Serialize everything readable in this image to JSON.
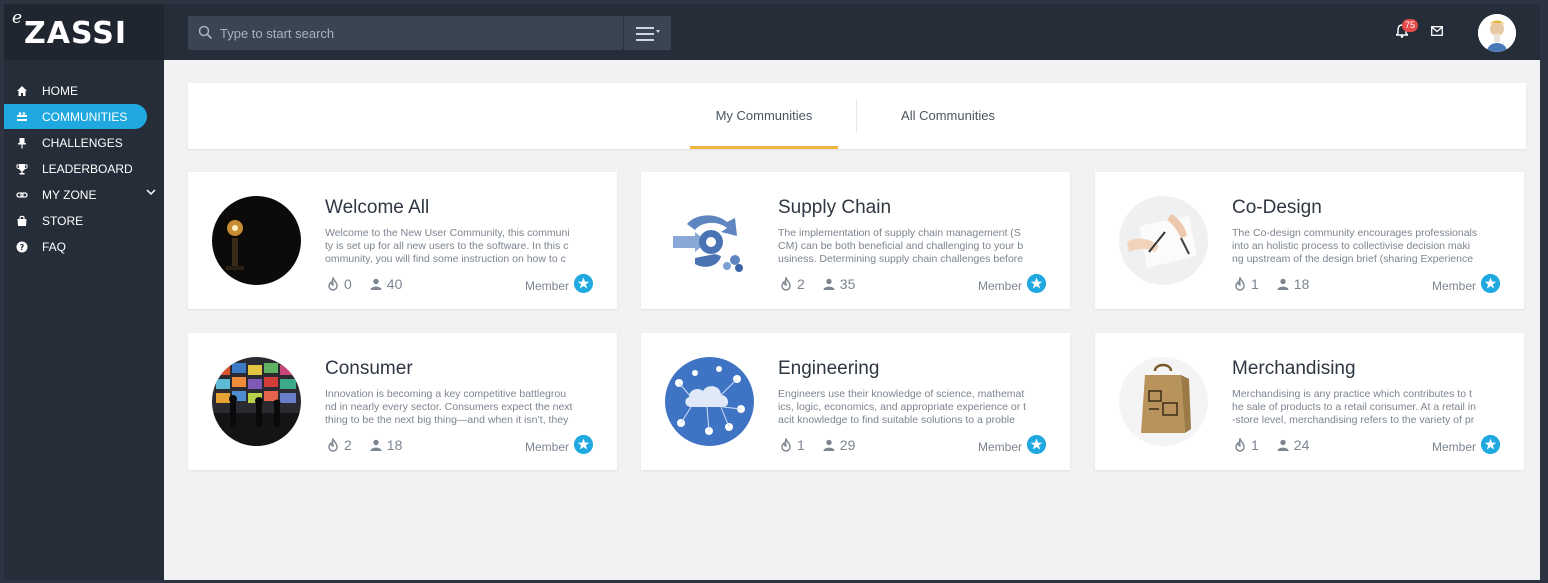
{
  "brand": {
    "logo_prefix": "e",
    "logo_name": "ZASSI"
  },
  "search": {
    "placeholder": "Type to start search"
  },
  "notifications": {
    "count": "75"
  },
  "sidebar": {
    "items": [
      {
        "label": "HOME",
        "icon": "home-icon"
      },
      {
        "label": "COMMUNITIES",
        "icon": "communities-icon",
        "active": true
      },
      {
        "label": "CHALLENGES",
        "icon": "pin-icon"
      },
      {
        "label": "LEADERBOARD",
        "icon": "trophy-icon"
      },
      {
        "label": "MY ZONE",
        "icon": "link-icon",
        "expandable": true
      },
      {
        "label": "STORE",
        "icon": "store-icon"
      },
      {
        "label": "FAQ",
        "icon": "help-icon"
      }
    ]
  },
  "tabs": [
    {
      "label": "My Communities",
      "active": true
    },
    {
      "label": "All Communities"
    }
  ],
  "communities": [
    {
      "title": "Welcome All",
      "description": "Welcome to the New User Community, this communi\nty is set up for all new users to the software. In this c\nommunity, you will find some instruction on how to c",
      "challenges": "0",
      "members": "40",
      "status": "Member"
    },
    {
      "title": "Supply Chain",
      "description": "The implementation of supply chain management (S\nCM) can be both beneficial and challenging to your b\nusiness. Determining supply chain challenges before",
      "challenges": "2",
      "members": "35",
      "status": "Member"
    },
    {
      "title": "Co-Design",
      "description": "The Co-design community encourages professionals\ninto an holistic process to collectivise decision maki\nng upstream of the design brief (sharing Experience",
      "challenges": "1",
      "members": "18",
      "status": "Member"
    },
    {
      "title": "Consumer",
      "description": "Innovation is becoming a key competitive battlegrou\nnd in nearly every sector. Consumers expect the next\nthing to be the next big thing—and when it isn’t, they",
      "challenges": "2",
      "members": "18",
      "status": "Member"
    },
    {
      "title": "Engineering",
      "description": "Engineers use their knowledge of science, mathemat\nics, logic, economics, and appropriate experience or t\nacit knowledge to find suitable solutions to a proble",
      "challenges": "1",
      "members": "29",
      "status": "Member"
    },
    {
      "title": "Merchandising",
      "description": "Merchandising is any practice which contributes to t\nhe sale of products to a retail consumer. At a retail in\n-store level, merchandising refers to the variety of pr",
      "challenges": "1",
      "members": "24",
      "status": "Member"
    }
  ],
  "colors": {
    "accent": "#20a8e0",
    "tab_underline": "#f0b43c",
    "sidebar_bg": "#252d38"
  }
}
